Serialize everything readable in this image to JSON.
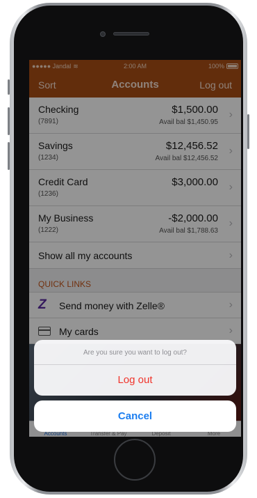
{
  "status_bar": {
    "carrier": "●●●●● Jandal",
    "time": "2:00 AM",
    "battery_percent": "100%"
  },
  "nav": {
    "left_label": "Sort",
    "title": "Accounts",
    "right_label": "Log out"
  },
  "accounts": [
    {
      "name": "Checking",
      "number": "(7891)",
      "balance": "$1,500.00",
      "available": "Avail bal $1,450.95"
    },
    {
      "name": "Savings",
      "number": "(1234)",
      "balance": "$12,456.52",
      "available": "Avail bal $12,456.52"
    },
    {
      "name": "Credit Card",
      "number": "(1236)",
      "balance": "$3,000.00",
      "available": ""
    },
    {
      "name": "My Business",
      "number": "(1222)",
      "balance": "-$2,000.00",
      "available": "Avail bal $1,788.63"
    }
  ],
  "show_all_label": "Show all my accounts",
  "quick_links": {
    "header": "QUICK LINKS",
    "items": [
      {
        "label": "Send money with Zelle®",
        "icon": "zelle-icon",
        "glyph": "Z"
      },
      {
        "label": "My cards",
        "icon": "card-icon"
      }
    ]
  },
  "tabs": [
    {
      "label": "Accounts",
      "active": true
    },
    {
      "label": "Transfer & Pay",
      "active": false
    },
    {
      "label": "Deposit",
      "active": false
    },
    {
      "label": "More",
      "active": false
    }
  ],
  "action_sheet": {
    "message": "Are you sure you want to log out?",
    "destructive_label": "Log out",
    "cancel_label": "Cancel"
  },
  "colors": {
    "brand": "#a94e16",
    "destructive": "#f0352c",
    "cancel": "#1c7ef0",
    "quick_links_header": "#c4551a"
  }
}
